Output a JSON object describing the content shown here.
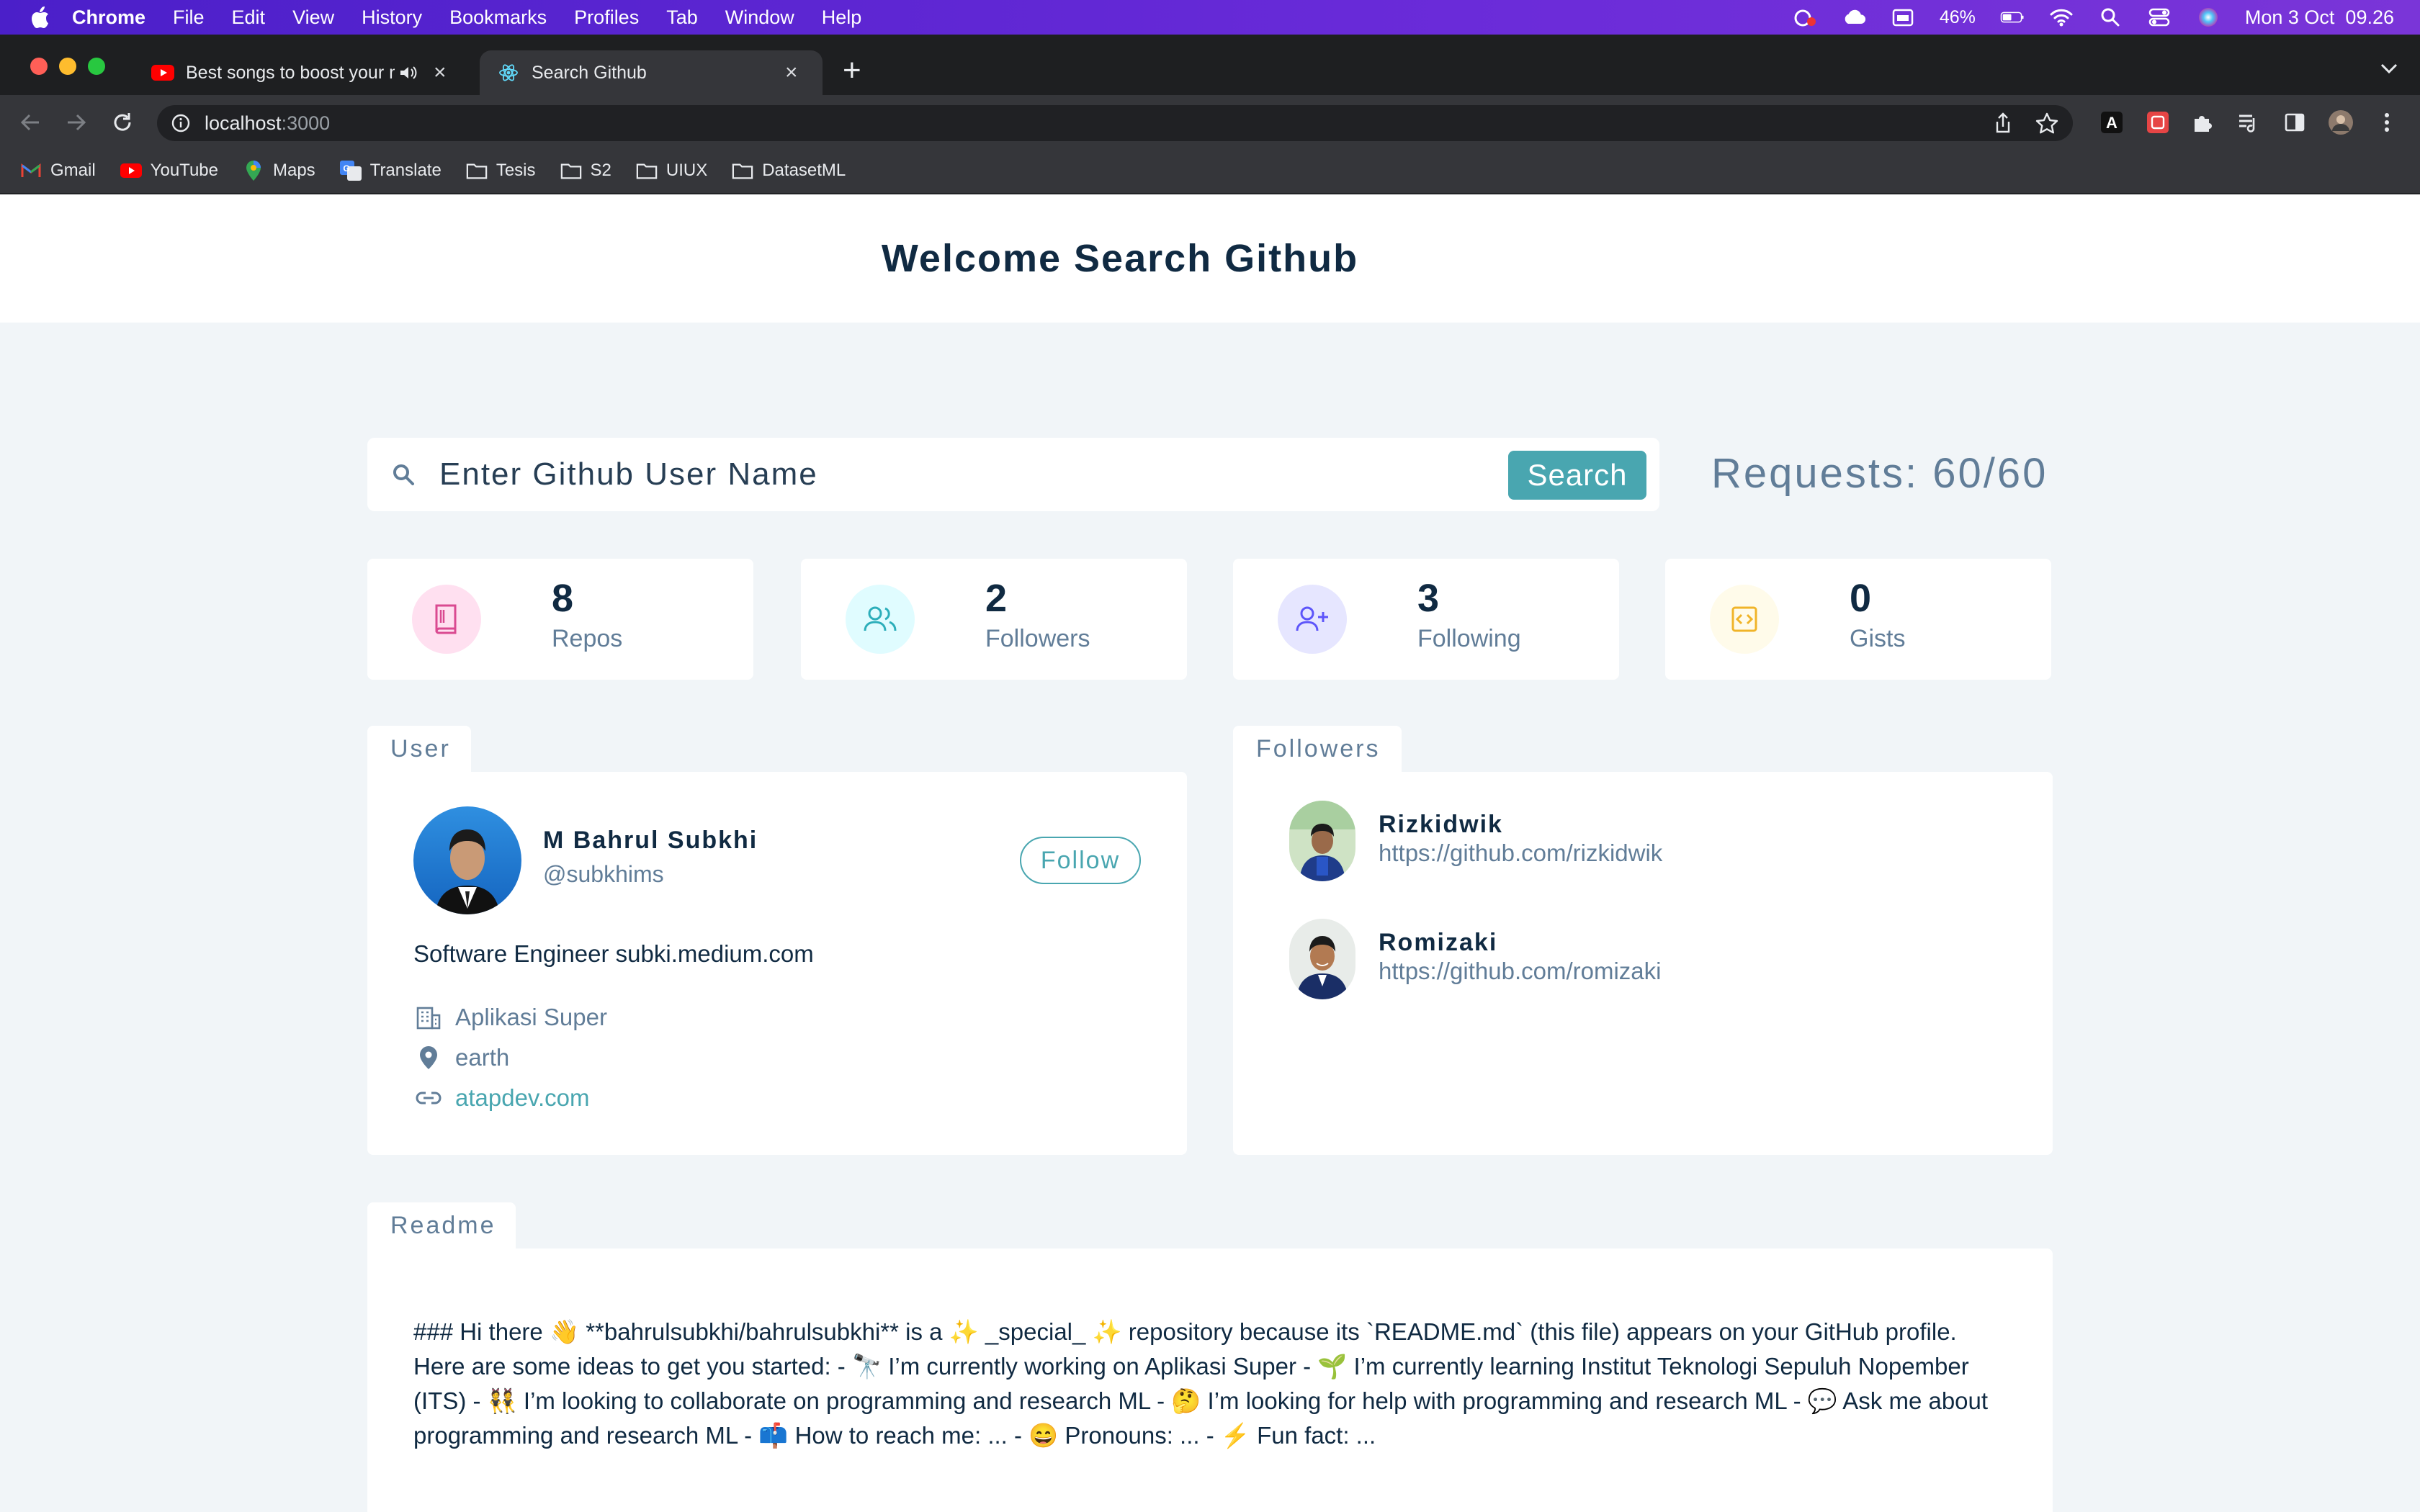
{
  "menubar": {
    "app": "Chrome",
    "items": [
      "File",
      "Edit",
      "View",
      "History",
      "Bookmarks",
      "Profiles",
      "Tab",
      "Window",
      "Help"
    ],
    "battery": "46%",
    "datetime": "Mon 3 Oct  09.26"
  },
  "tabs": [
    {
      "title": "Best songs to boost your m",
      "icon": "youtube-icon"
    },
    {
      "title": "Search Github",
      "icon": "react-icon"
    }
  ],
  "address": {
    "host": "localhost",
    "port": ":3000"
  },
  "bookmarks": [
    "Gmail",
    "YouTube",
    "Maps",
    "Translate",
    "Tesis",
    "S2",
    "UIUX",
    "DatasetML"
  ],
  "page": {
    "title": "Welcome Search Github",
    "search": {
      "placeholder": "Enter Github User Name",
      "button": "Search"
    },
    "requests": "Requests: 60/60",
    "stats": [
      {
        "value": "8",
        "label": "Repos",
        "color": "#da4a91",
        "bg": "#ffe0f0"
      },
      {
        "value": "2",
        "label": "Followers",
        "color": "#2caeba",
        "bg": "#e0fcff"
      },
      {
        "value": "3",
        "label": "Following",
        "color": "#5d55fa",
        "bg": "#e6e6ff"
      },
      {
        "value": "0",
        "label": "Gists",
        "color": "#f0b429",
        "bg": "#fffbea"
      }
    ],
    "user": {
      "tab": "User",
      "name": "M Bahrul Subkhi",
      "login": "@subkhims",
      "follow": "Follow",
      "bio": "Software Engineer subki.medium.com",
      "company": "Aplikasi Super",
      "location": "earth",
      "blog": "atapdev.com"
    },
    "followers": {
      "tab": "Followers",
      "items": [
        {
          "name": "Rizkidwik",
          "url": "https://github.com/rizkidwik"
        },
        {
          "name": "Romizaki",
          "url": "https://github.com/romizaki"
        }
      ]
    },
    "readme": {
      "tab": "Readme",
      "text": "### Hi there 👋 **bahrulsubkhi/bahrulsubkhi** is a ✨ _special_ ✨ repository because its `README.md` (this file) appears on your GitHub profile. Here are some ideas to get you started: - 🔭 I’m currently working on Aplikasi Super - 🌱 I’m currently learning Institut Teknologi Sepuluh Nopember (ITS) - 👯 I’m looking to collaborate on programming and research ML - 🤔 I’m looking for help with programming and research ML - 💬 Ask me about programming and research ML - 📫 How to reach me: ... - 😄 Pronouns: ... - ⚡ Fun fact: ..."
    }
  }
}
